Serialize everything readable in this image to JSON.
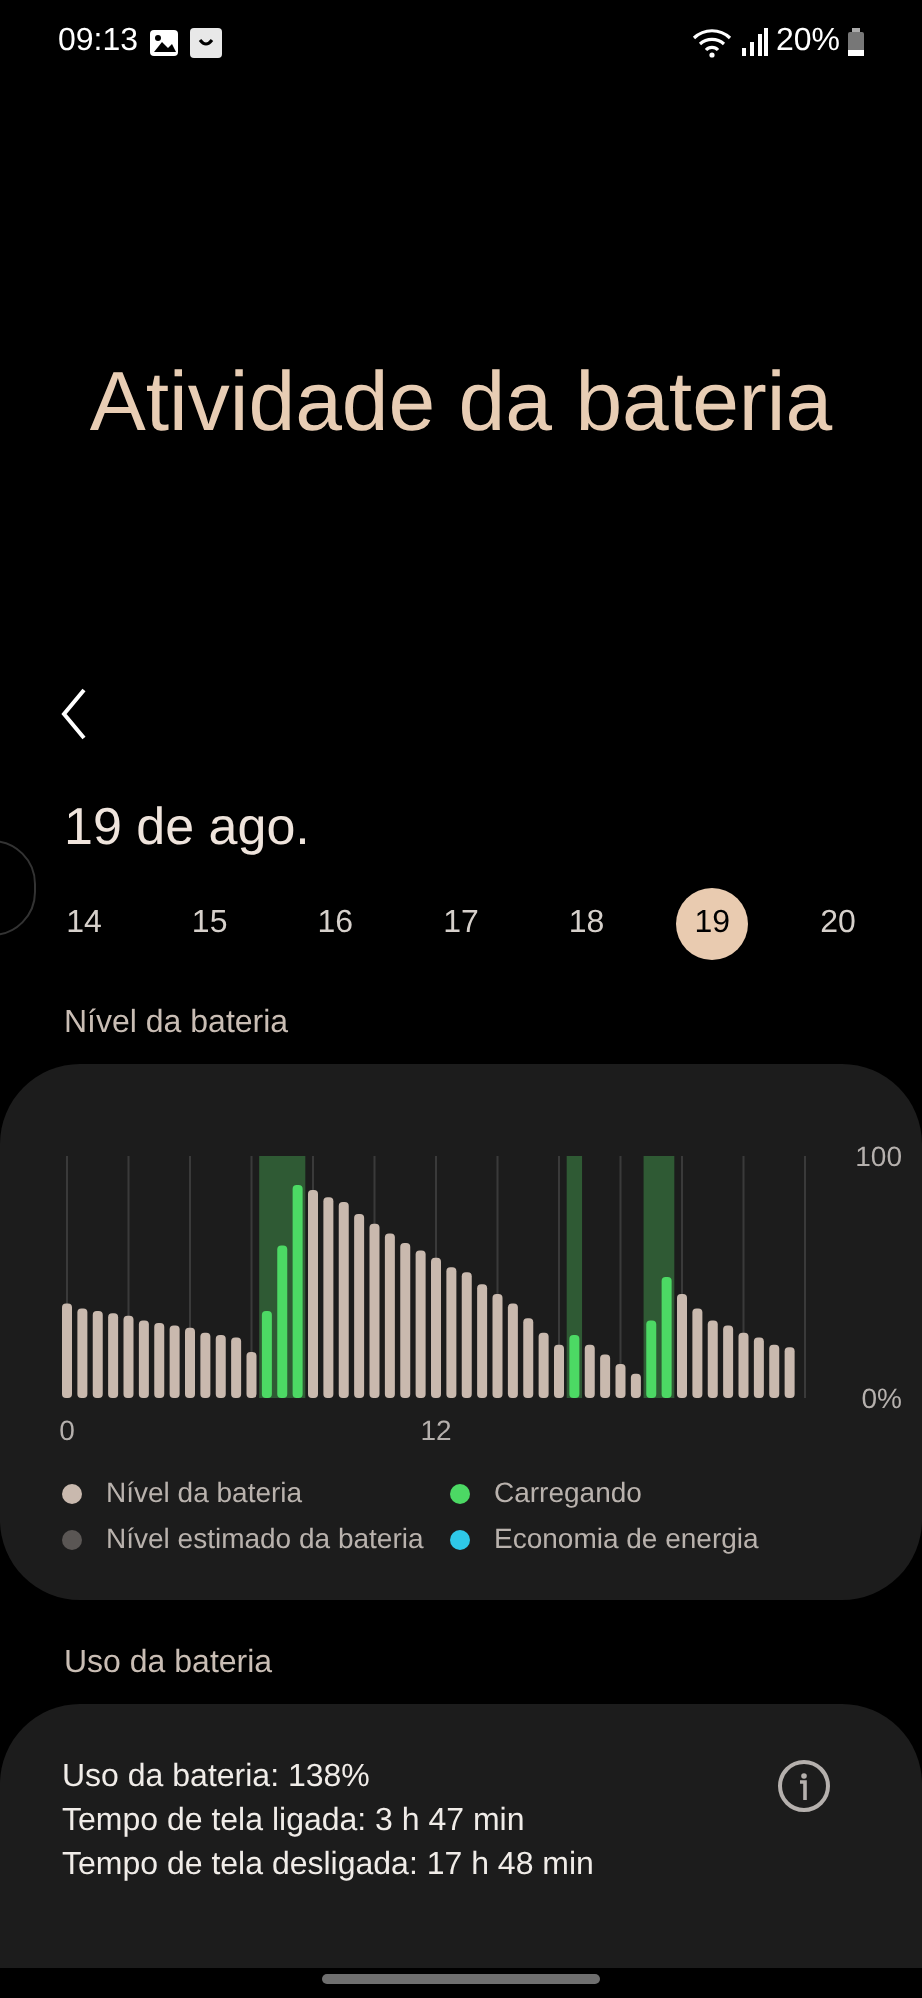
{
  "status_bar": {
    "time": "09:13",
    "battery": "20%"
  },
  "title": "Atividade da bateria",
  "date": "19 de ago.",
  "days": [
    {
      "label": "14",
      "selected": false
    },
    {
      "label": "15",
      "selected": false
    },
    {
      "label": "16",
      "selected": false
    },
    {
      "label": "17",
      "selected": false
    },
    {
      "label": "18",
      "selected": false
    },
    {
      "label": "19",
      "selected": true
    },
    {
      "label": "20",
      "selected": false
    }
  ],
  "battery_level": {
    "heading": "Nível da bateria",
    "chart_data": {
      "type": "bar",
      "xlim": [
        0,
        24
      ],
      "bands": [
        {
          "axis": "x",
          "from": 6.25,
          "to": 7.75
        },
        {
          "axis": "x",
          "from": 16.25,
          "to": 16.75
        },
        {
          "axis": "x",
          "from": 18.75,
          "to": 19.75
        }
      ],
      "x": [
        0,
        0.5,
        1,
        1.5,
        2,
        2.5,
        3,
        3.5,
        4,
        4.5,
        5,
        5.5,
        6,
        6.5,
        7,
        7.5,
        8,
        8.5,
        9,
        9.5,
        10,
        10.5,
        11,
        11.5,
        12,
        12.5,
        13,
        13.5,
        14,
        14.5,
        15,
        15.5,
        16,
        16.5,
        17,
        17.5,
        18,
        18.5,
        19,
        19.5,
        20,
        20.5,
        21,
        21.5,
        22,
        22.5,
        23,
        23.5
      ],
      "series": [
        {
          "name": "Nível da bateria",
          "color": "#c9b9ae",
          "values": [
            39,
            37,
            36,
            35,
            34,
            32,
            31,
            30,
            29,
            27,
            26,
            25,
            19,
            null,
            null,
            null,
            86,
            83,
            81,
            76,
            72,
            68,
            64,
            61,
            58,
            54,
            52,
            47,
            43,
            39,
            33,
            27,
            22,
            null,
            22,
            18,
            14,
            10,
            null,
            null,
            43,
            37,
            32,
            30,
            27,
            25,
            22,
            21
          ]
        },
        {
          "name": "Carregando",
          "color": "#4cd964",
          "values": [
            null,
            null,
            null,
            null,
            null,
            null,
            null,
            null,
            null,
            null,
            null,
            null,
            null,
            36,
            63,
            88,
            null,
            null,
            null,
            null,
            null,
            null,
            null,
            null,
            null,
            null,
            null,
            null,
            null,
            null,
            null,
            null,
            null,
            26,
            null,
            null,
            null,
            null,
            32,
            50,
            null,
            null,
            null,
            null,
            null,
            null,
            null,
            null
          ]
        }
      ],
      "xticks": [
        0,
        12
      ],
      "yticks": [
        {
          "value": 0,
          "label": "0%"
        },
        {
          "value": 100,
          "label": "100"
        }
      ],
      "ylim": [
        0,
        100
      ]
    },
    "legend": [
      {
        "label": "Nível estimado da bateria",
        "color": "#5a5654"
      },
      {
        "label": "Economia de energia",
        "color": "#2ec8e8"
      }
    ]
  },
  "battery_usage": {
    "heading": "Uso da bateria",
    "lines": [
      "Uso da bateria: 138%",
      "Tempo de tela ligada: 3 h 47 min",
      "Tempo de tela desligada: 17 h 48 min"
    ]
  }
}
